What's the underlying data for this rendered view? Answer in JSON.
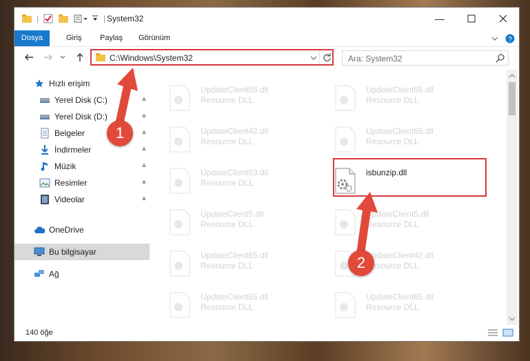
{
  "window": {
    "title": "System32",
    "controls": [
      "minimize",
      "maximize",
      "close"
    ]
  },
  "ribbon": {
    "tabs": [
      "Dosya",
      "Giriş",
      "Paylaş",
      "Görünüm"
    ]
  },
  "address": {
    "path": "C:\\Windows\\System32",
    "search_placeholder": "Ara: System32"
  },
  "nav": {
    "quick_access": "Hızlı erişim",
    "items": [
      {
        "label": "Yerel Disk (C:)",
        "icon": "drive-icon",
        "pinned": true
      },
      {
        "label": "Yerel Disk (D:)",
        "icon": "drive-icon",
        "pinned": true
      },
      {
        "label": "Belgeler",
        "icon": "documents-icon",
        "pinned": true
      },
      {
        "label": "İndirmeler",
        "icon": "download-icon",
        "pinned": true
      },
      {
        "label": "Müzik",
        "icon": "music-icon",
        "pinned": true
      },
      {
        "label": "Resimler",
        "icon": "pictures-icon",
        "pinned": true
      },
      {
        "label": "Videolar",
        "icon": "video-icon",
        "pinned": true
      }
    ],
    "onedrive": "OneDrive",
    "this_pc": "Bu bilgisayar",
    "network": "Ağ"
  },
  "files": {
    "left_column": [
      {
        "name": "UpdateClient65.dll",
        "type": "Resource DLL"
      },
      {
        "name": "UpdateClient42.dll",
        "type": "Resource DLL"
      },
      {
        "name": "UpdateClient63.dll",
        "type": "Resource DLL"
      },
      {
        "name": "UpdateClient5.dll",
        "type": "Resource DLL"
      },
      {
        "name": "UpdateClient65.dll",
        "type": "Resource DLL"
      },
      {
        "name": "UpdateClient65.dll",
        "type": "Resource DLL"
      }
    ],
    "right_column": [
      {
        "name": "UpdateClient65.dll",
        "type": "Resource DLL"
      },
      {
        "name": "UpdateClient65.dll",
        "type": "Resource DLL"
      },
      {
        "name": "isbunzip.dll",
        "type": ""
      },
      {
        "name": "UpdateClient5.dll",
        "type": "Resource DLL"
      },
      {
        "name": "UpdateClient42.dll",
        "type": "Resource DLL"
      },
      {
        "name": "UpdateClient65.dll",
        "type": "Resource DLL"
      }
    ]
  },
  "status": {
    "count": "140 öğe"
  },
  "annotations": {
    "step1": "1",
    "step2": "2",
    "accent": "#e14a3a"
  }
}
